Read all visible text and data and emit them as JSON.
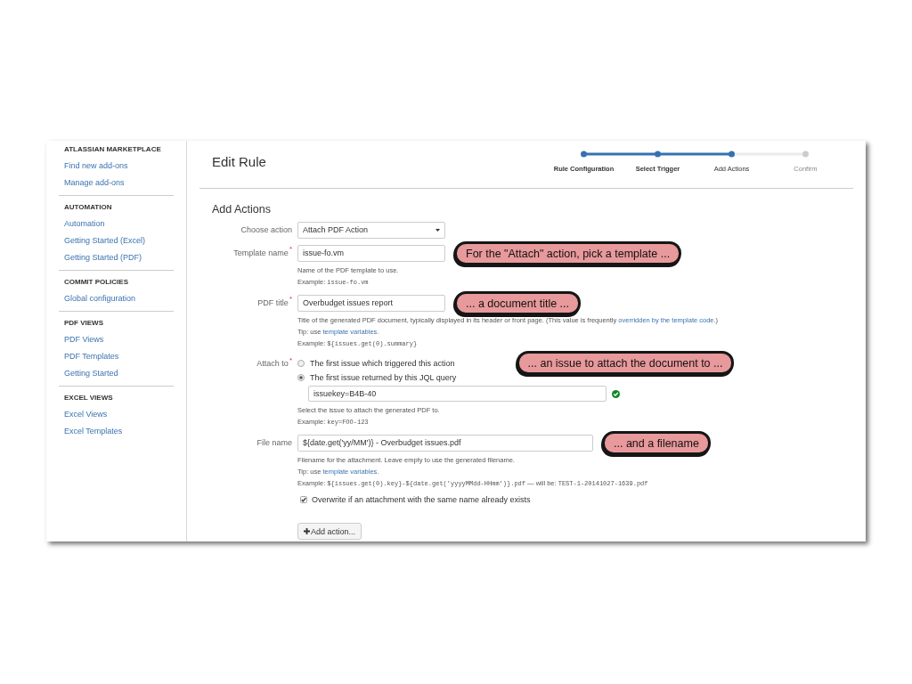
{
  "sidebar": {
    "sections": [
      {
        "heading": "ATLASSIAN MARKETPLACE",
        "items": [
          "Find new add-ons",
          "Manage add-ons"
        ]
      },
      {
        "heading": "AUTOMATION",
        "items": [
          "Automation",
          "Getting Started (Excel)",
          "Getting Started (PDF)"
        ]
      },
      {
        "heading": "COMMIT POLICIES",
        "items": [
          "Global configuration"
        ]
      },
      {
        "heading": "PDF VIEWS",
        "items": [
          "PDF Views",
          "PDF Templates",
          "Getting Started"
        ]
      },
      {
        "heading": "EXCEL VIEWS",
        "items": [
          "Excel Views",
          "Excel Templates"
        ]
      }
    ]
  },
  "header": {
    "title": "Edit Rule",
    "steps": [
      {
        "label": "Rule Configuration",
        "selected": false
      },
      {
        "label": "Select Trigger",
        "selected": false
      },
      {
        "label": "Add Actions",
        "selected": true
      },
      {
        "label": "Confirm",
        "selected": false
      }
    ]
  },
  "form": {
    "heading": "Add Actions",
    "fields": [
      {
        "kind": "select",
        "label": "Choose action",
        "value": "Attach PDF Action"
      },
      {
        "kind": "text",
        "label": "Template name",
        "required_mark": "*",
        "value": "issue-fo.vm",
        "callout": "For the \"Attach\" action, pick a template ...",
        "help": [
          {
            "kind": "plain",
            "text": "Name of the PDF template to use."
          },
          {
            "kind": "example",
            "label": "Example:",
            "code": "issue-fo.vm"
          }
        ]
      },
      {
        "kind": "text",
        "label": "PDF title",
        "required_mark": "*",
        "value": "Overbudget issues report",
        "callout": "... a document title ...",
        "help": [
          {
            "kind": "link",
            "before": "Title of the generated PDF document, typically displayed in its header or front page. (This value is frequently ",
            "link": "overridden by the template code",
            "after": ".)"
          },
          {
            "kind": "link",
            "before": "Tip: use ",
            "link": "template variables",
            "after": "."
          },
          {
            "kind": "example",
            "label": "Example:",
            "code": "${issues.get(0).summary}"
          }
        ]
      },
      {
        "kind": "radio",
        "label": "Attach to",
        "required_mark": "*",
        "callout": "... an issue to attach the document to ...",
        "options": [
          {
            "label": "The first issue which triggered this action",
            "selected": false
          },
          {
            "label": "The first issue returned by this JQL query",
            "selected": true
          }
        ],
        "query": {
          "value": "issuekey=B4B-40",
          "valid": true
        },
        "help": [
          {
            "kind": "plain",
            "text": "Select the issue to attach the generated PDF to."
          },
          {
            "kind": "example",
            "label": "Example:",
            "code": "key=FOO-123"
          }
        ]
      },
      {
        "kind": "text",
        "label": "File name",
        "value": "${date.get('yy/MM')} - Overbudget issues.pdf",
        "callout": "... and a filename",
        "help": [
          {
            "kind": "plain",
            "text": "Filename for the attachment. Leave empty to use the generated filename."
          },
          {
            "kind": "link",
            "before": "Tip: use ",
            "link": "template variables",
            "after": "."
          },
          {
            "kind": "example",
            "label": "Example:",
            "code": "${issues.get(0).key}-${date.get('yyyyMMdd-HHmm')}.pdf",
            "middle": "— will be:",
            "result": "TEST-1-20141027-1639.pdf"
          }
        ]
      },
      {
        "kind": "checkbox",
        "label": "Overwrite if an attachment with the same name already exists",
        "checked": true
      }
    ],
    "add_button": "Add action..."
  }
}
